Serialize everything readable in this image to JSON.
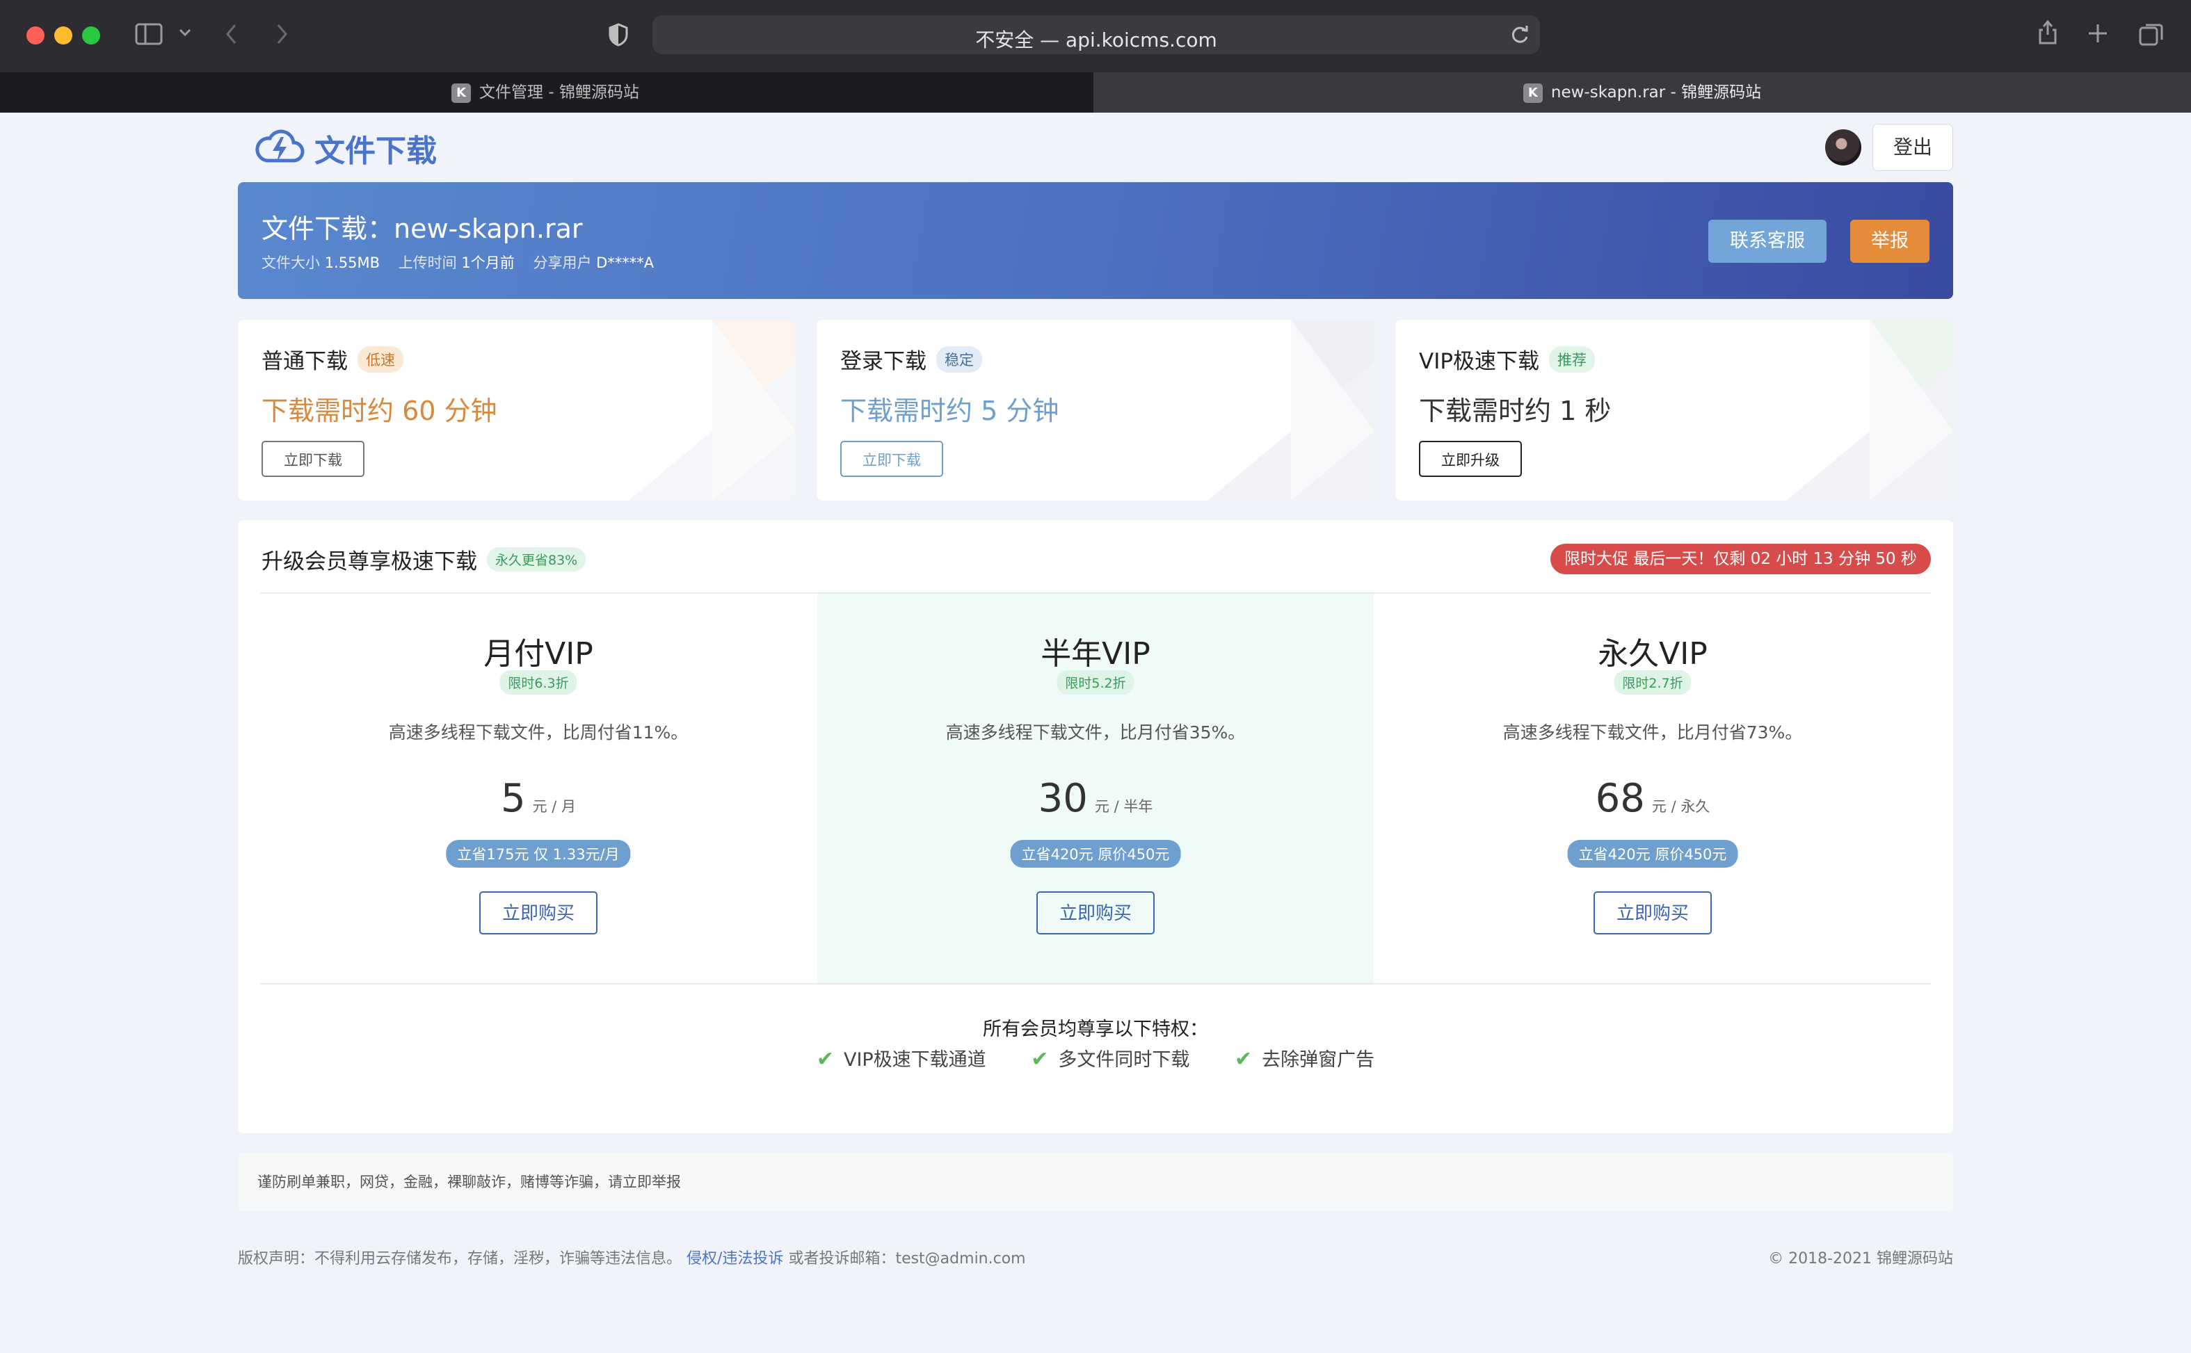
{
  "browser": {
    "url": "不安全 — api.koicms.com",
    "tabs": [
      {
        "label": "文件管理 - 锦鲤源码站",
        "favicon": "K"
      },
      {
        "label": "new-skapn.rar - 锦鲤源码站",
        "favicon": "K"
      }
    ]
  },
  "header": {
    "brand": "文件下载",
    "logout": "登出"
  },
  "banner": {
    "title": "文件下载：new-skapn.rar",
    "size_label": "文件大小",
    "size_value": "1.55MB",
    "upload_label": "上传时间",
    "upload_value": "1个月前",
    "share_label": "分享用户",
    "share_value": "D*****A",
    "service_button": "联系客服",
    "report_button": "举报"
  },
  "download_options": [
    {
      "title": "普通下载",
      "tag": "低速",
      "time": "下载需时约 60 分钟",
      "button": "立即下载",
      "accent": "#d8893f"
    },
    {
      "title": "登录下载",
      "tag": "稳定",
      "time": "下载需时约 5 分钟",
      "button": "立即下载",
      "accent": "#6fa0cc"
    },
    {
      "title": "VIP极速下载",
      "tag": "推荐",
      "time": "下载需时约 1 秒",
      "button": "立即升级",
      "accent": "#333333"
    }
  ],
  "vip": {
    "heading": "升级会员尊享极速下载",
    "heading_tag": "永久更省83%",
    "promo": "限时大促 最后一天！仅剩 02 小时 13 分钟 50 秒",
    "plans": [
      {
        "name": "月付VIP",
        "discount": "限时6.3折",
        "desc": "高速多线程下载文件，比周付省11%。",
        "price": "5",
        "unit": "元 / 月",
        "save": "立省175元 仅 1.33元/月",
        "buy": "立即购买"
      },
      {
        "name": "半年VIP",
        "discount": "限时5.2折",
        "desc": "高速多线程下载文件，比月付省35%。",
        "price": "30",
        "unit": "元 / 半年",
        "save": "立省420元 原价450元",
        "buy": "立即购买"
      },
      {
        "name": "永久VIP",
        "discount": "限时2.7折",
        "desc": "高速多线程下载文件，比月付省73%。",
        "price": "68",
        "unit": "元 / 永久",
        "save": "立省420元 原价450元",
        "buy": "立即购买"
      }
    ],
    "perks_title": "所有会员均尊享以下特权：",
    "perks": [
      "VIP极速下载通道",
      "多文件同时下载",
      "去除弹窗广告"
    ]
  },
  "notice": "谨防刷单兼职，网贷，金融，裸聊敲诈，赌博等诈骗，请立即举报",
  "footer": {
    "copyright_statement": "版权声明：不得利用云存储发布，存储，淫秽，诈骗等违法信息。",
    "complaint_link": "侵权/违法投诉",
    "email_text": "或者投诉邮箱：test@admin.com",
    "copyright": "© 2018-2021 锦鲤源码站"
  },
  "colors": {
    "accent": "#4a74c9",
    "banner_start": "#5a88ce",
    "banner_end": "#3a4ba0",
    "report": "#e58c3a",
    "promo": "#d84b4b"
  }
}
